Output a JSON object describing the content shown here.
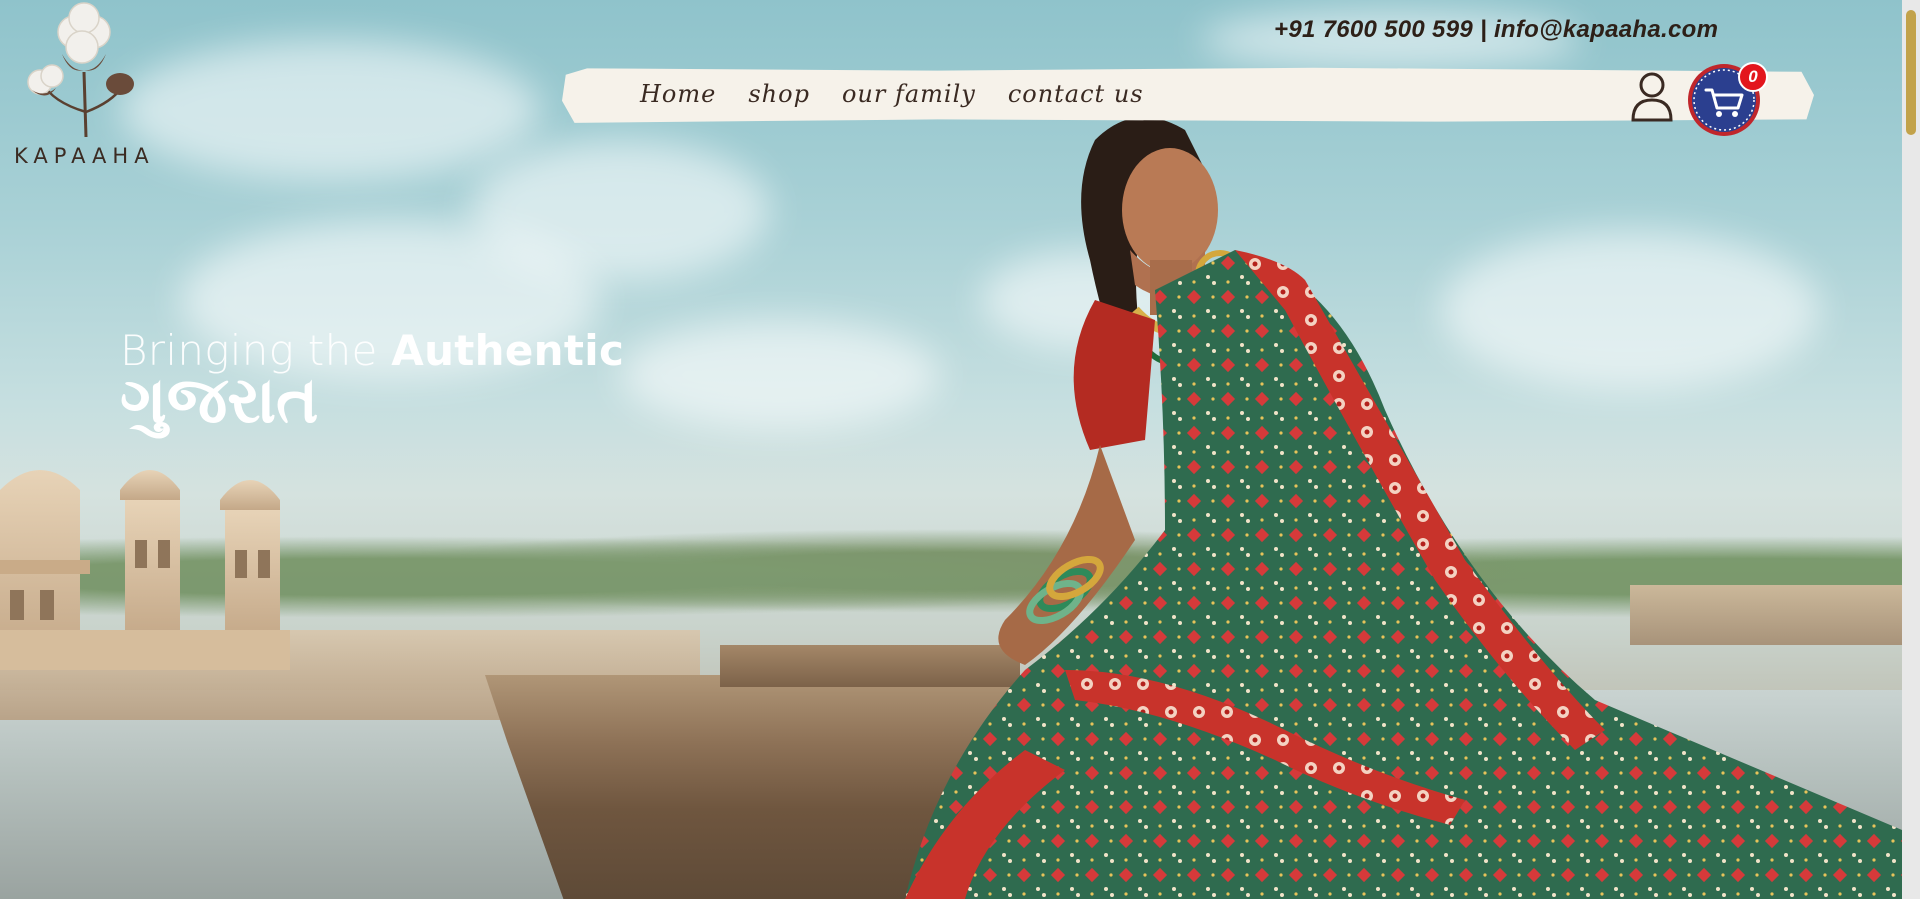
{
  "brand": {
    "name": "KAPAAHA",
    "logo_icon": "cotton-flower-icon"
  },
  "contact": {
    "phone": "+91 7600 500 599",
    "separator": "|",
    "email": "info@kapaaha.com"
  },
  "nav": {
    "items": [
      {
        "label": "Home"
      },
      {
        "label": "shop"
      },
      {
        "label": "our family"
      },
      {
        "label": "contact us"
      }
    ]
  },
  "actions": {
    "user_icon": "user-icon",
    "cart_icon": "shopping-cart-icon",
    "cart_count": "0"
  },
  "hero": {
    "line1_light": "Bringing the",
    "line1_bold": "Authentic",
    "line2": "ગુજરાત"
  },
  "colors": {
    "text_dark": "#2d2018",
    "badge": "#e3161d",
    "cart_ring": "#2b3f8f",
    "scroll_thumb": "#c2a24a"
  }
}
